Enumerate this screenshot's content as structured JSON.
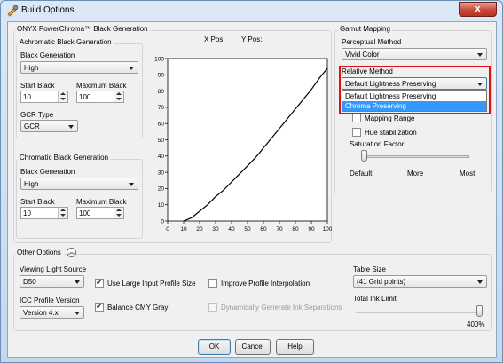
{
  "window": {
    "title": "Build Options",
    "icon": "build-options-app-icon",
    "close_label": "x"
  },
  "powerchroma": {
    "group_label": "ONYX PowerChroma™ Black Generation",
    "x_pos_label": "X Pos:",
    "y_pos_label": "Y Pos:",
    "achromatic": {
      "group_label": "Achromatic Black Generation",
      "black_generation_label": "Black Generation",
      "black_generation_value": "High",
      "start_black_label": "Start Black",
      "start_black_value": "10",
      "maximum_black_label": "Maximum Black",
      "maximum_black_value": "100",
      "gcr_type_label": "GCR Type",
      "gcr_type_value": "GCR"
    },
    "chromatic": {
      "group_label": "Chromatic Black Generation",
      "black_generation_label": "Black Generation",
      "black_generation_value": "High",
      "start_black_label": "Start Black",
      "start_black_value": "10",
      "maximum_black_label": "Maximum Black",
      "maximum_black_value": "100"
    }
  },
  "gamut": {
    "group_label": "Gamut Mapping",
    "perceptual_method_label": "Perceptual Method",
    "perceptual_method_value": "Vivid Color",
    "relative_method_label": "Relative Method",
    "relative_method_value": "Default Lightness Preserving",
    "relative_method_options": [
      "Default Lightness Preserving",
      "Chroma Preserving"
    ],
    "relative_method_highlighted": "Chroma Preserving",
    "mapping_range_label": "Mapping Range",
    "hue_stabilization_label": "Hue stabilization",
    "saturation_factor_label": "Saturation Factor:",
    "saturation_level": 0,
    "saturation_ticks": [
      "Default",
      "More",
      "Most"
    ]
  },
  "other": {
    "group_label": "Other Options",
    "collapse_icon": "double-chevron-up-icon",
    "viewing_light_source_label": "Viewing Light Source",
    "viewing_light_source_value": "D50",
    "use_large_input_profile_label": "Use Large Input Profile Size",
    "use_large_input_profile_checked": true,
    "improve_profile_interpolation_label": "Improve Profile Interpolation",
    "improve_profile_interpolation_checked": false,
    "icc_profile_version_label": "ICC Profile Version",
    "icc_profile_version_value": "Version 4.x",
    "balance_cmy_gray_label": "Balance CMY Gray",
    "balance_cmy_gray_checked": true,
    "dynamic_ink_separations_label": "Dynamically Generate Ink Separations",
    "dynamic_ink_separations_checked": false,
    "table_size_label": "Table Size",
    "table_size_value": "(41 Grid points)",
    "total_ink_limit_label": "Total Ink Limit",
    "total_ink_limit_value": "400%",
    "total_ink_limit_level": 1.0
  },
  "buttons": {
    "ok": "OK",
    "cancel": "Cancel",
    "help": "Help"
  },
  "chart_data": {
    "type": "line",
    "title": "",
    "xlabel": "",
    "ylabel": "",
    "xlim": [
      0,
      100
    ],
    "ylim": [
      0,
      100
    ],
    "x_ticks": [
      "0",
      "10",
      "20",
      "30",
      "40",
      "50",
      "60",
      "70",
      "80",
      "90",
      "100"
    ],
    "y_ticks": [
      "0",
      "10",
      "20",
      "30",
      "40",
      "50",
      "60",
      "70",
      "80",
      "90",
      "100"
    ],
    "series": [
      {
        "x": [
          10,
          15,
          20,
          25,
          30,
          35,
          40,
          45,
          50,
          55,
          60,
          65,
          70,
          75,
          80,
          85,
          90,
          95,
          100
        ],
        "y": [
          0,
          2,
          6,
          10,
          15,
          19,
          24,
          29,
          34,
          39,
          45,
          51,
          57,
          63,
          69,
          75,
          81,
          88,
          94
        ]
      }
    ],
    "grid": false,
    "colors": [
      "#000000"
    ]
  }
}
